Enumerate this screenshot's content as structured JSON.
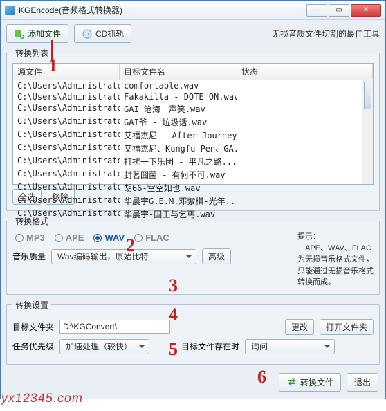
{
  "window": {
    "title": "KGEncode(音频格式转换器)"
  },
  "toolbar": {
    "add_label": "添加文件",
    "cd_label": "CD抓轨",
    "tagline": "无损音质文件切割的最佳工具"
  },
  "list": {
    "legend": "转换列表",
    "col_src": "源文件",
    "col_dst": "目标文件名",
    "col_status": "状态",
    "rows": [
      {
        "src": "C:\\Users\\Administrator\\D...",
        "dst": "comfortable.wav"
      },
      {
        "src": "C:\\Users\\Administrator\\D...",
        "dst": "Fakakilla - DOTE ON.wav"
      },
      {
        "src": "C:\\Users\\Administrator\\D...",
        "dst": "GAI 沧海一声笑.wav"
      },
      {
        "src": "C:\\Users\\Administrator\\D...",
        "dst": "GAI爷 - 垃圾话.wav"
      },
      {
        "src": "C:\\Users\\Administrator\\D...",
        "dst": "艾福杰尼 - After Journey..."
      },
      {
        "src": "C:\\Users\\Administrator\\D...",
        "dst": "艾福杰尼、Kungfu-Pen、GA..."
      },
      {
        "src": "C:\\Users\\Administrator\\D...",
        "dst": "打扰一下乐团 - 平凡之路..."
      },
      {
        "src": "C:\\Users\\Administrator\\D...",
        "dst": "封茗囧菌 - 有何不可.wav"
      },
      {
        "src": "C:\\Users\\Administrator\\D...",
        "dst": "胡66-空空如也.wav"
      },
      {
        "src": "C:\\Users\\Administrator\\D...",
        "dst": "华晨宇G.E.M.邓紫棋-光年..."
      },
      {
        "src": "C:\\Users\\Administrator\\D...",
        "dst": "华晨宇-国王与乞丐.wav"
      }
    ],
    "select_all": "全选",
    "remove": "移除"
  },
  "format": {
    "legend": "转换格式",
    "mp3": "MP3",
    "ape": "APE",
    "wav": "WAV",
    "flac": "FLAC",
    "hint_label": "提示：",
    "hint_text": "APE、WAV、FLAC为无损音乐格式文件，只能通过无损音乐格式转换而成。",
    "quality_label": "音乐质量",
    "quality_value": "Wav编码输出，原始比特",
    "advanced": "高级"
  },
  "settings": {
    "legend": "转换设置",
    "target_label": "目标文件夹",
    "target_value": "D:\\KGConvert\\",
    "change": "更改",
    "open": "打开文件夹",
    "priority_label": "任务优先级",
    "priority_value": "加速处理（较快）",
    "exists_label": "目标文件存在时",
    "exists_value": "询问"
  },
  "bottom": {
    "convert": "转换文件",
    "exit": "退出"
  },
  "annot": {
    "a1": "1",
    "a2": "2",
    "a3": "3",
    "a4": "4",
    "a5": "5",
    "a6": "6"
  },
  "watermark": "yx12345.com"
}
